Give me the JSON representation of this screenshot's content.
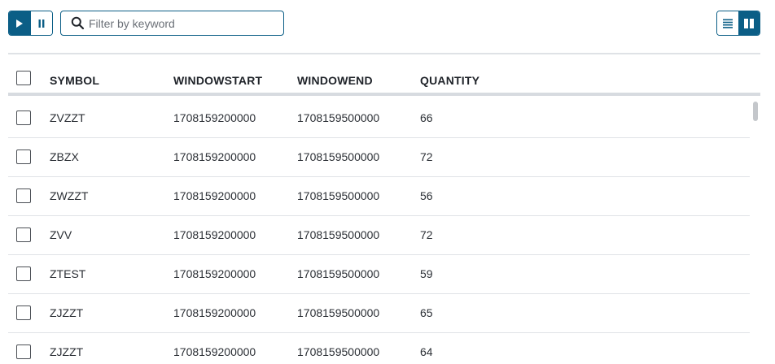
{
  "toolbar": {
    "play_icon": "play-icon",
    "pause_icon": "pause-icon",
    "search_placeholder": "Filter by keyword",
    "search_value": "",
    "list_view_icon": "list-view-icon",
    "split_view_icon": "split-view-icon",
    "accent_color": "#0b5e86"
  },
  "table": {
    "columns": [
      "SYMBOL",
      "WINDOWSTART",
      "WINDOWEND",
      "QUANTITY"
    ],
    "rows": [
      {
        "symbol": "ZVZZT",
        "windowstart": "1708159200000",
        "windowend": "1708159500000",
        "quantity": "66"
      },
      {
        "symbol": "ZBZX",
        "windowstart": "1708159200000",
        "windowend": "1708159500000",
        "quantity": "72"
      },
      {
        "symbol": "ZWZZT",
        "windowstart": "1708159200000",
        "windowend": "1708159500000",
        "quantity": "56"
      },
      {
        "symbol": "ZVV",
        "windowstart": "1708159200000",
        "windowend": "1708159500000",
        "quantity": "72"
      },
      {
        "symbol": "ZTEST",
        "windowstart": "1708159200000",
        "windowend": "1708159500000",
        "quantity": "59"
      },
      {
        "symbol": "ZJZZT",
        "windowstart": "1708159200000",
        "windowend": "1708159500000",
        "quantity": "65"
      },
      {
        "symbol": "ZJZZT",
        "windowstart": "1708159200000",
        "windowend": "1708159500000",
        "quantity": "64"
      }
    ]
  }
}
